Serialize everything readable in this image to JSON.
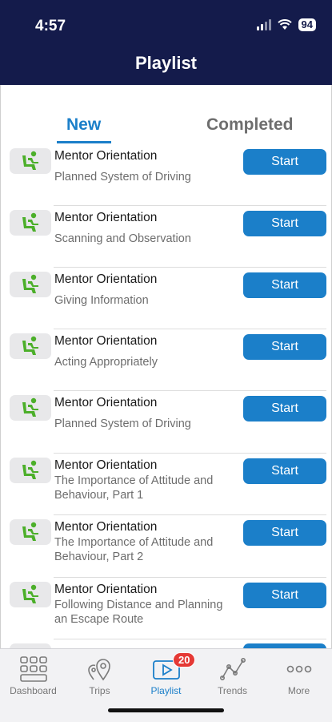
{
  "status_bar": {
    "time": "4:57",
    "battery": "94"
  },
  "header": {
    "title": "Playlist"
  },
  "tabs": [
    {
      "label": "New",
      "active": true
    },
    {
      "label": "Completed",
      "active": false
    }
  ],
  "items": [
    {
      "title": "Mentor Orientation",
      "subtitle": "Planned System of Driving",
      "button": "Start"
    },
    {
      "title": "Mentor Orientation",
      "subtitle": "Scanning and Observation",
      "button": "Start"
    },
    {
      "title": "Mentor Orientation",
      "subtitle": "Giving Information",
      "button": "Start"
    },
    {
      "title": "Mentor Orientation",
      "subtitle": "Acting Appropriately",
      "button": "Start"
    },
    {
      "title": "Mentor Orientation",
      "subtitle": "Planned System of Driving",
      "button": "Start"
    },
    {
      "title": "Mentor Orientation",
      "subtitle": "The Importance of Attitude and Behaviour, Part 1",
      "button": "Start"
    },
    {
      "title": "Mentor Orientation",
      "subtitle": "The Importance of Attitude and Behaviour, Part 2",
      "button": "Start"
    },
    {
      "title": "Mentor Orientation",
      "subtitle": "Following Distance and Planning an Escape Route",
      "button": "Start"
    }
  ],
  "tabbar": [
    {
      "label": "Dashboard",
      "icon": "dashboard-icon"
    },
    {
      "label": "Trips",
      "icon": "location-pins-icon"
    },
    {
      "label": "Playlist",
      "icon": "video-play-icon",
      "badge": "20",
      "active": true
    },
    {
      "label": "Trends",
      "icon": "trend-line-icon"
    },
    {
      "label": "More",
      "icon": "more-dots-icon"
    }
  ],
  "colors": {
    "header_bg": "#141b4b",
    "accent": "#1b7fc9",
    "badge": "#e53935",
    "driver_icon": "#4caf2a"
  }
}
